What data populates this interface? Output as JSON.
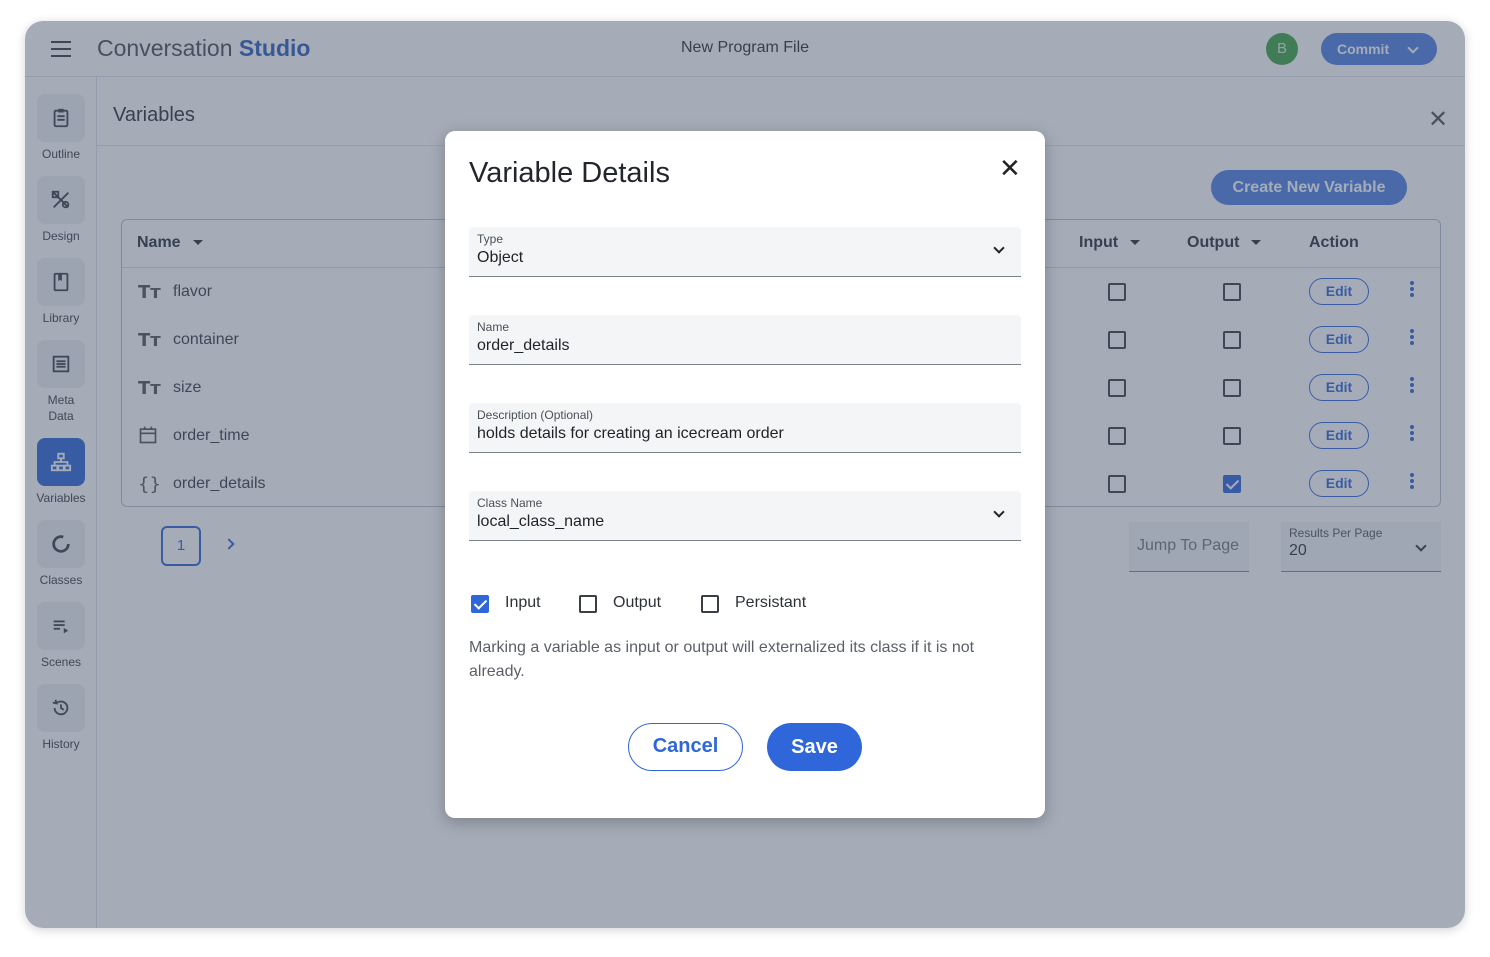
{
  "header": {
    "brand_light": "Conversation",
    "brand_bold": "Studio",
    "doc_title": "New Program File",
    "avatar_initial": "B",
    "commit_label": "Commit"
  },
  "sidebar": {
    "items": [
      {
        "label": "Outline",
        "icon": "clipboard-icon"
      },
      {
        "label": "Design",
        "icon": "design-tools-icon"
      },
      {
        "label": "Library",
        "icon": "bookmark-icon"
      },
      {
        "label": "Meta Data",
        "icon": "list-icon"
      },
      {
        "label": "Variables",
        "icon": "hierarchy-icon",
        "active": true
      },
      {
        "label": "Classes",
        "icon": "donut-icon"
      },
      {
        "label": "Scenes",
        "icon": "playlist-icon"
      },
      {
        "label": "History",
        "icon": "history-icon"
      }
    ]
  },
  "panel": {
    "title": "Variables",
    "create_label": "Create New Variable",
    "columns": {
      "name": "Name",
      "input": "Input",
      "output": "Output",
      "action": "Action"
    },
    "rows": [
      {
        "icon": "Tт",
        "name": "flavor",
        "input": false,
        "output": false,
        "action": "Edit"
      },
      {
        "icon": "Tт",
        "name": "container",
        "input": false,
        "output": false,
        "action": "Edit"
      },
      {
        "icon": "Tт",
        "name": "size",
        "input": false,
        "output": false,
        "action": "Edit"
      },
      {
        "icon": "calendar",
        "name": "order_time",
        "input": false,
        "output": false,
        "action": "Edit"
      },
      {
        "icon": "{}",
        "name": "order_details",
        "input": false,
        "output": true,
        "action": "Edit"
      }
    ],
    "pagination": {
      "current_page": "1",
      "jump_placeholder": "Jump To Page",
      "rpp_label": "Results Per Page",
      "rpp_value": "20"
    }
  },
  "modal": {
    "title": "Variable Details",
    "type": {
      "label": "Type",
      "value": "Object"
    },
    "name": {
      "label": "Name",
      "value": "order_details"
    },
    "description": {
      "label": "Description (Optional)",
      "value": "holds details for creating an icecream order"
    },
    "class_name": {
      "label": "Class Name",
      "value": "local_class_name"
    },
    "checkboxes": {
      "input": "Input",
      "output": "Output",
      "persistant": "Persistant",
      "input_checked": true,
      "output_checked": false,
      "persistant_checked": false
    },
    "help_text": "Marking a variable as input or output will externalized its class if it is not already.",
    "cancel_label": "Cancel",
    "save_label": "Save"
  },
  "colors": {
    "accent": "#2f66d9",
    "overlay": "#42526a"
  }
}
